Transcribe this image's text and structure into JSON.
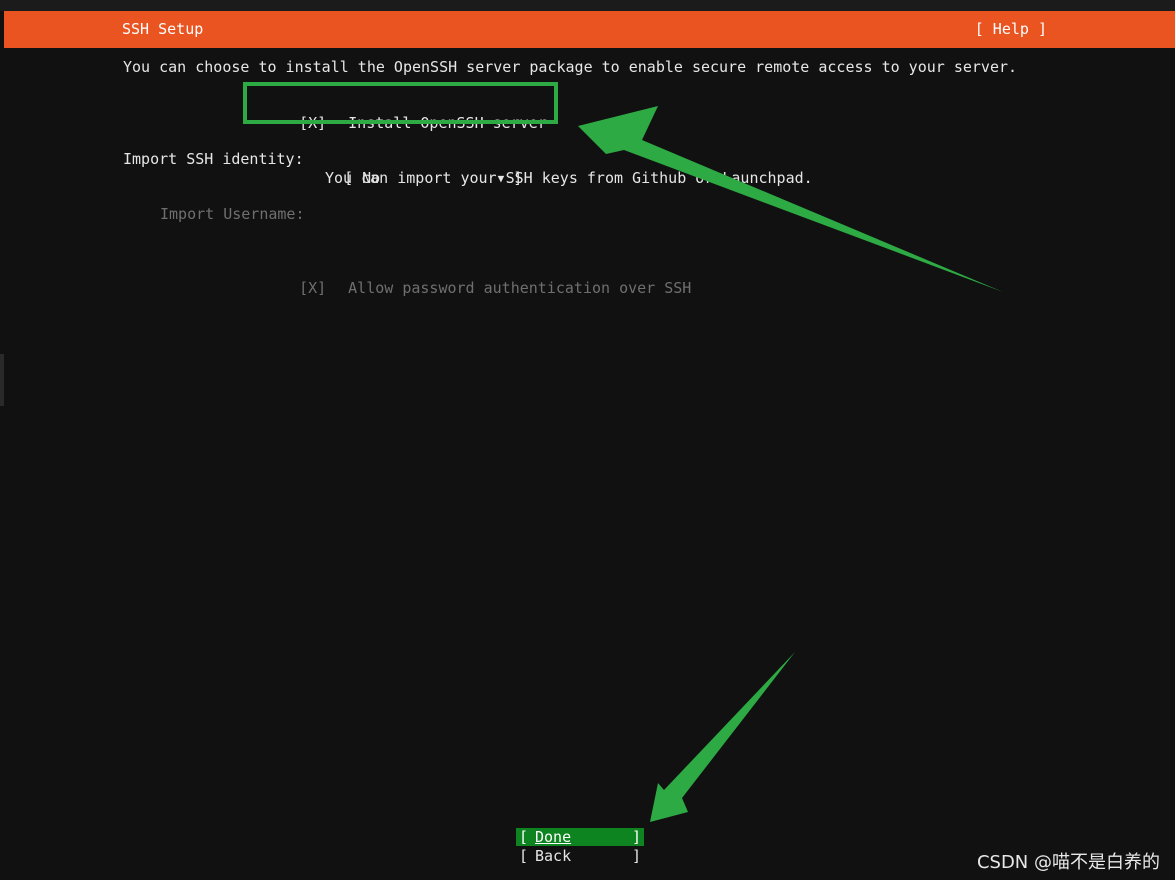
{
  "header": {
    "title": "SSH Setup",
    "help_label": "[ Help ]"
  },
  "intro_text": "You can choose to install the OpenSSH server package to enable secure remote access to your server.",
  "install_openssh": {
    "checkbox": "[X]",
    "label": "Install OpenSSH server",
    "checked": true
  },
  "import_identity": {
    "label": "Import SSH identity:",
    "bracket_open": "[",
    "value": "No",
    "caret": "▼",
    "bracket_close": "]",
    "hint": "You can import your SSH keys from Github or Launchpad."
  },
  "import_username": {
    "label": "Import Username:"
  },
  "allow_password": {
    "checkbox": "[X]",
    "label": "Allow password authentication over SSH",
    "checked": true
  },
  "buttons": {
    "done": {
      "open": "[",
      "label": "Done",
      "close": "]"
    },
    "back": {
      "open": "[",
      "label": "Back",
      "close": "]"
    }
  },
  "watermark": "CSDN @喵不是白养的",
  "colors": {
    "header": "#e95420",
    "highlight": "#2eaa45",
    "done_button": "#0e8420",
    "background": "#111111"
  }
}
